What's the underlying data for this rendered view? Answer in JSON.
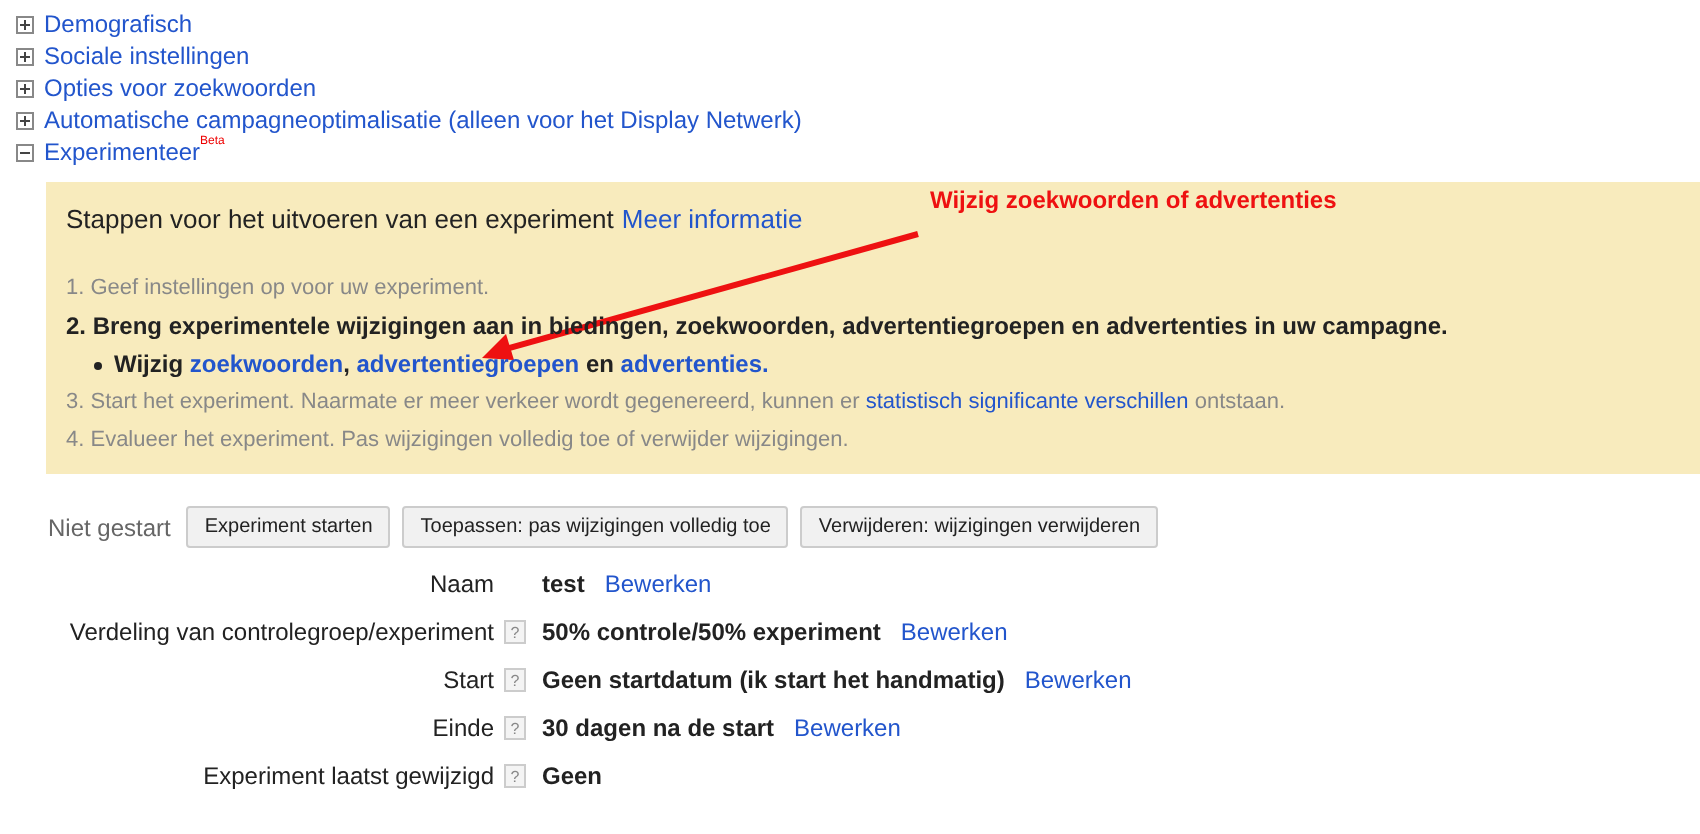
{
  "sections": [
    {
      "label": "Demografisch",
      "expanded": false
    },
    {
      "label": "Sociale instellingen",
      "expanded": false
    },
    {
      "label": "Opties voor zoekwoorden",
      "expanded": false
    },
    {
      "label": "Automatische campagneoptimalisatie (alleen voor het Display Netwerk)",
      "expanded": false
    },
    {
      "label": "Experimenteer",
      "badge": "Beta",
      "expanded": true
    }
  ],
  "panel": {
    "title": "Stappen voor het uitvoeren van een experiment",
    "title_link": "Meer informatie",
    "steps": [
      {
        "kind": "done",
        "parts": [
          {
            "text": "1. Geef instellingen op voor uw experiment."
          }
        ]
      },
      {
        "kind": "current",
        "parts": [
          {
            "text": "2. Breng experimentele wijzigingen aan in biedingen, zoekwoorden, advertentiegroepen en advertenties in uw campagne."
          }
        ]
      },
      {
        "kind": "bullet",
        "parts": [
          {
            "text": "Wijzig "
          },
          {
            "text": "zoekwoorden",
            "link": true
          },
          {
            "text": ", "
          },
          {
            "text": "advertentiegroepen",
            "link": true
          },
          {
            "text": " en "
          },
          {
            "text": "advertenties.",
            "link": true
          }
        ]
      },
      {
        "kind": "pending",
        "parts": [
          {
            "text": "3. Start het experiment. Naarmate er meer verkeer wordt gegenereerd, kunnen er "
          },
          {
            "text": "statistisch significante verschillen",
            "link": true
          },
          {
            "text": " ontstaan."
          }
        ]
      },
      {
        "kind": "pending",
        "parts": [
          {
            "text": "4. Evalueer het experiment. Pas wijzigingen volledig toe of verwijder wijzigingen."
          }
        ]
      }
    ],
    "annotation": "Wijzig zoekwoorden of advertenties"
  },
  "status": "Niet gestart",
  "buttons": [
    "Experiment starten",
    "Toepassen: pas wijzigingen volledig toe",
    "Verwijderen: wijzigingen verwijderen"
  ],
  "details": [
    {
      "label": "Naam",
      "value": "test",
      "action": "Bewerken"
    },
    {
      "label": "Verdeling van controlegroep/experiment",
      "help": "?",
      "value": "50% controle/50% experiment",
      "action": "Bewerken"
    },
    {
      "label": "Start",
      "help": "?",
      "value": "Geen startdatum (ik start het handmatig)",
      "action": "Bewerken"
    },
    {
      "label": "Einde",
      "help": "?",
      "value": "30 dagen na de start",
      "action": "Bewerken"
    },
    {
      "label": "Experiment laatst gewijzigd",
      "help": "?",
      "value": "Geen"
    }
  ]
}
